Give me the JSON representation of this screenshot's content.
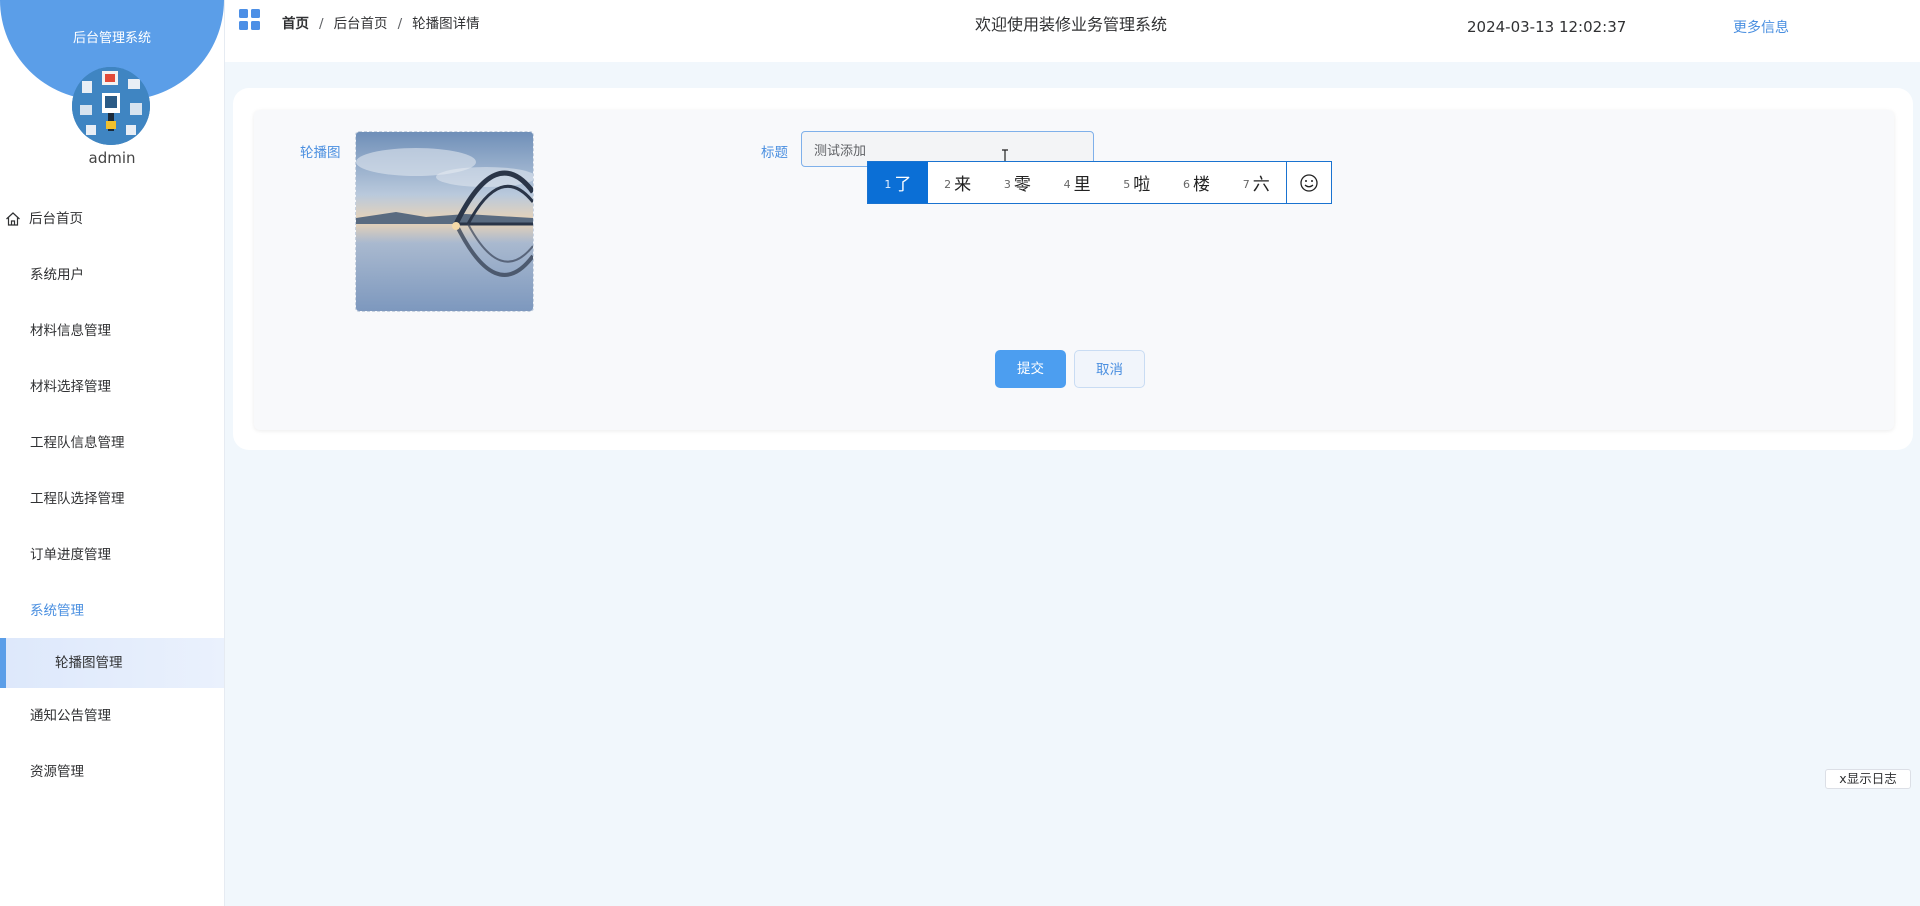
{
  "sidebar": {
    "title": "后台管理系统",
    "username": "admin",
    "items": [
      {
        "label": "后台首页"
      },
      {
        "label": "系统用户"
      },
      {
        "label": "材料信息管理"
      },
      {
        "label": "材料选择管理"
      },
      {
        "label": "工程队信息管理"
      },
      {
        "label": "工程队选择管理"
      },
      {
        "label": "订单进度管理"
      },
      {
        "label": "系统管理"
      },
      {
        "label": "轮播图管理"
      },
      {
        "label": "通知公告管理"
      },
      {
        "label": "资源管理"
      }
    ]
  },
  "header": {
    "breadcrumbs": [
      "首页",
      "后台首页",
      "轮播图详情"
    ],
    "separator": "/",
    "welcome": "欢迎使用装修业务管理系统",
    "datetime": "2024-03-13 12:02:37",
    "more_info": "更多信息"
  },
  "form": {
    "image_label": "轮播图",
    "title_label": "标题",
    "title_value": "测试添加",
    "submit_label": "提交",
    "cancel_label": "取消"
  },
  "ime": {
    "candidates": [
      {
        "n": "1",
        "text": "了"
      },
      {
        "n": "2",
        "text": "来"
      },
      {
        "n": "3",
        "text": "零"
      },
      {
        "n": "4",
        "text": "里"
      },
      {
        "n": "5",
        "text": "啦"
      },
      {
        "n": "6",
        "text": "楼"
      },
      {
        "n": "7",
        "text": "六"
      }
    ],
    "emoji_icon": "smiley-icon"
  },
  "log_toggle": "x显示日志",
  "colors": {
    "accent": "#4a8fe0",
    "sidebar_head": "#5b9ee8",
    "submit": "#4c9ef0",
    "ime_selected": "#0b6fd6"
  }
}
